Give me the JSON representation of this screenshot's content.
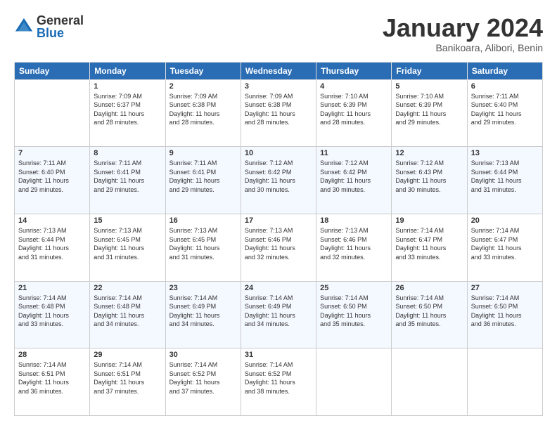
{
  "logo": {
    "general": "General",
    "blue": "Blue"
  },
  "header": {
    "month": "January 2024",
    "location": "Banikoara, Alibori, Benin"
  },
  "weekdays": [
    "Sunday",
    "Monday",
    "Tuesday",
    "Wednesday",
    "Thursday",
    "Friday",
    "Saturday"
  ],
  "weeks": [
    [
      {
        "day": "",
        "info": ""
      },
      {
        "day": "1",
        "info": "Sunrise: 7:09 AM\nSunset: 6:37 PM\nDaylight: 11 hours\nand 28 minutes."
      },
      {
        "day": "2",
        "info": "Sunrise: 7:09 AM\nSunset: 6:38 PM\nDaylight: 11 hours\nand 28 minutes."
      },
      {
        "day": "3",
        "info": "Sunrise: 7:09 AM\nSunset: 6:38 PM\nDaylight: 11 hours\nand 28 minutes."
      },
      {
        "day": "4",
        "info": "Sunrise: 7:10 AM\nSunset: 6:39 PM\nDaylight: 11 hours\nand 28 minutes."
      },
      {
        "day": "5",
        "info": "Sunrise: 7:10 AM\nSunset: 6:39 PM\nDaylight: 11 hours\nand 29 minutes."
      },
      {
        "day": "6",
        "info": "Sunrise: 7:11 AM\nSunset: 6:40 PM\nDaylight: 11 hours\nand 29 minutes."
      }
    ],
    [
      {
        "day": "7",
        "info": "Sunrise: 7:11 AM\nSunset: 6:40 PM\nDaylight: 11 hours\nand 29 minutes."
      },
      {
        "day": "8",
        "info": "Sunrise: 7:11 AM\nSunset: 6:41 PM\nDaylight: 11 hours\nand 29 minutes."
      },
      {
        "day": "9",
        "info": "Sunrise: 7:11 AM\nSunset: 6:41 PM\nDaylight: 11 hours\nand 29 minutes."
      },
      {
        "day": "10",
        "info": "Sunrise: 7:12 AM\nSunset: 6:42 PM\nDaylight: 11 hours\nand 30 minutes."
      },
      {
        "day": "11",
        "info": "Sunrise: 7:12 AM\nSunset: 6:42 PM\nDaylight: 11 hours\nand 30 minutes."
      },
      {
        "day": "12",
        "info": "Sunrise: 7:12 AM\nSunset: 6:43 PM\nDaylight: 11 hours\nand 30 minutes."
      },
      {
        "day": "13",
        "info": "Sunrise: 7:13 AM\nSunset: 6:44 PM\nDaylight: 11 hours\nand 31 minutes."
      }
    ],
    [
      {
        "day": "14",
        "info": "Sunrise: 7:13 AM\nSunset: 6:44 PM\nDaylight: 11 hours\nand 31 minutes."
      },
      {
        "day": "15",
        "info": "Sunrise: 7:13 AM\nSunset: 6:45 PM\nDaylight: 11 hours\nand 31 minutes."
      },
      {
        "day": "16",
        "info": "Sunrise: 7:13 AM\nSunset: 6:45 PM\nDaylight: 11 hours\nand 31 minutes."
      },
      {
        "day": "17",
        "info": "Sunrise: 7:13 AM\nSunset: 6:46 PM\nDaylight: 11 hours\nand 32 minutes."
      },
      {
        "day": "18",
        "info": "Sunrise: 7:13 AM\nSunset: 6:46 PM\nDaylight: 11 hours\nand 32 minutes."
      },
      {
        "day": "19",
        "info": "Sunrise: 7:14 AM\nSunset: 6:47 PM\nDaylight: 11 hours\nand 33 minutes."
      },
      {
        "day": "20",
        "info": "Sunrise: 7:14 AM\nSunset: 6:47 PM\nDaylight: 11 hours\nand 33 minutes."
      }
    ],
    [
      {
        "day": "21",
        "info": "Sunrise: 7:14 AM\nSunset: 6:48 PM\nDaylight: 11 hours\nand 33 minutes."
      },
      {
        "day": "22",
        "info": "Sunrise: 7:14 AM\nSunset: 6:48 PM\nDaylight: 11 hours\nand 34 minutes."
      },
      {
        "day": "23",
        "info": "Sunrise: 7:14 AM\nSunset: 6:49 PM\nDaylight: 11 hours\nand 34 minutes."
      },
      {
        "day": "24",
        "info": "Sunrise: 7:14 AM\nSunset: 6:49 PM\nDaylight: 11 hours\nand 34 minutes."
      },
      {
        "day": "25",
        "info": "Sunrise: 7:14 AM\nSunset: 6:50 PM\nDaylight: 11 hours\nand 35 minutes."
      },
      {
        "day": "26",
        "info": "Sunrise: 7:14 AM\nSunset: 6:50 PM\nDaylight: 11 hours\nand 35 minutes."
      },
      {
        "day": "27",
        "info": "Sunrise: 7:14 AM\nSunset: 6:50 PM\nDaylight: 11 hours\nand 36 minutes."
      }
    ],
    [
      {
        "day": "28",
        "info": "Sunrise: 7:14 AM\nSunset: 6:51 PM\nDaylight: 11 hours\nand 36 minutes."
      },
      {
        "day": "29",
        "info": "Sunrise: 7:14 AM\nSunset: 6:51 PM\nDaylight: 11 hours\nand 37 minutes."
      },
      {
        "day": "30",
        "info": "Sunrise: 7:14 AM\nSunset: 6:52 PM\nDaylight: 11 hours\nand 37 minutes."
      },
      {
        "day": "31",
        "info": "Sunrise: 7:14 AM\nSunset: 6:52 PM\nDaylight: 11 hours\nand 38 minutes."
      },
      {
        "day": "",
        "info": ""
      },
      {
        "day": "",
        "info": ""
      },
      {
        "day": "",
        "info": ""
      }
    ]
  ]
}
